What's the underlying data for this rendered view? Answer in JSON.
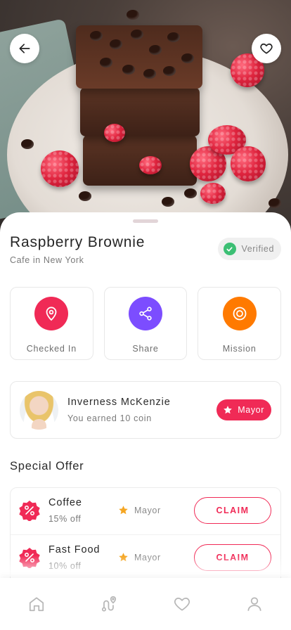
{
  "place": {
    "name": "Raspberry Brownie",
    "subtitle": "Cafe in New York",
    "verified_label": "Verified"
  },
  "actions": [
    {
      "label": "Checked In",
      "icon": "location-pin-icon",
      "color": "#f02a56"
    },
    {
      "label": "Share",
      "icon": "share-icon",
      "color": "#7c4dff"
    },
    {
      "label": "Mission",
      "icon": "target-icon",
      "color": "#ff7a00"
    }
  ],
  "mayor": {
    "name": "Inverness McKenzie",
    "subtitle": "You earned 10 coin",
    "badge_label": "Mayor"
  },
  "special_offer": {
    "title": "Special Offer",
    "items": [
      {
        "name": "Coffee",
        "discount": "15% off",
        "tag": "Mayor",
        "action": "CLAIM"
      },
      {
        "name": "Fast Food",
        "discount": "10% off",
        "tag": "Mayor",
        "action": "CLAIM"
      }
    ]
  },
  "tabbar": [
    {
      "icon": "home-icon"
    },
    {
      "icon": "route-icon"
    },
    {
      "icon": "heart-icon"
    },
    {
      "icon": "profile-icon"
    }
  ],
  "colors": {
    "accent": "#f02a56",
    "verified": "#3cbf74",
    "star": "#f5a623"
  }
}
